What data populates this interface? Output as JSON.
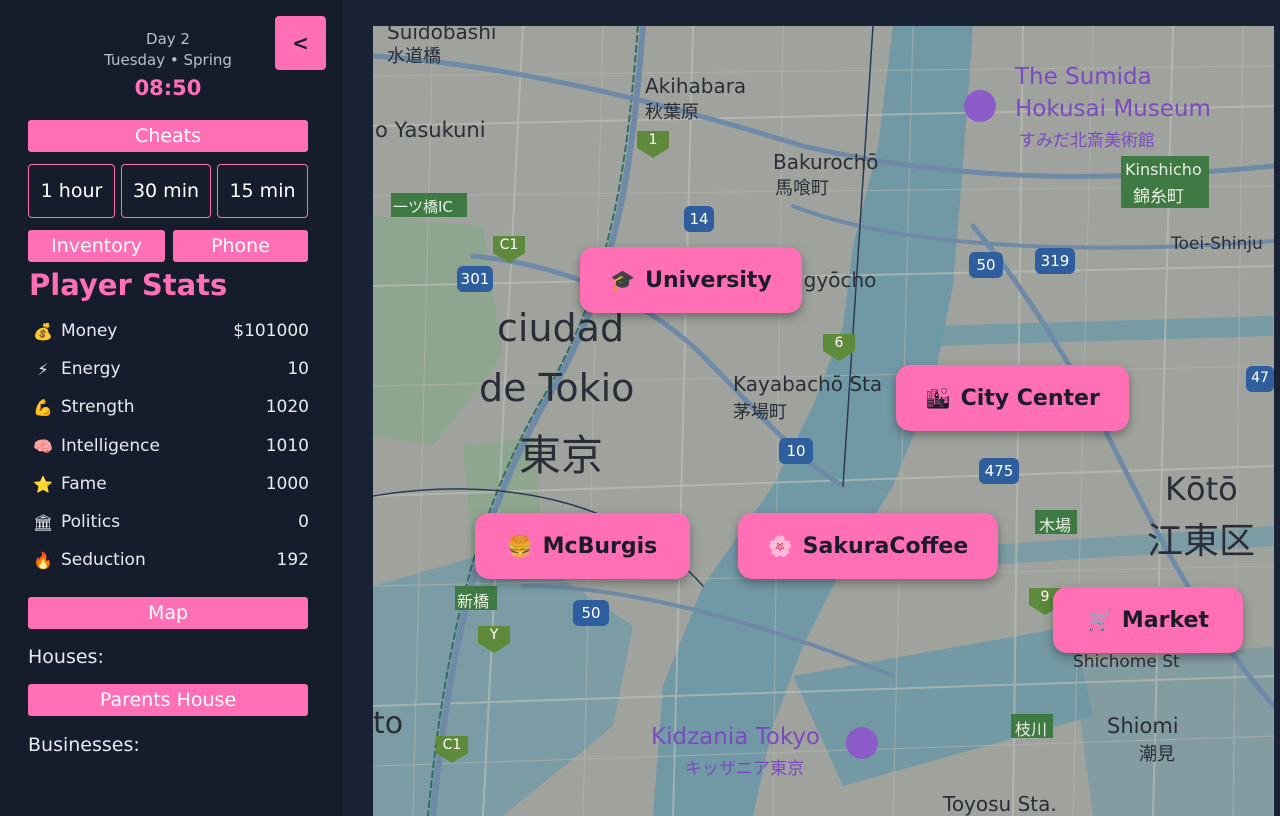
{
  "clock": {
    "day": "Day 2",
    "weekday_season": "Tuesday • Spring",
    "time": "08:50"
  },
  "collapse_label": "<",
  "cheats_label": "Cheats",
  "time_buttons": [
    "1 hour",
    "30 min",
    "15 min"
  ],
  "inventory_label": "Inventory",
  "phone_label": "Phone",
  "stats": {
    "title": "Player Stats",
    "rows": [
      {
        "icon": "💰",
        "icon_name": "money-bag-icon",
        "label": "Money",
        "value": "$101000"
      },
      {
        "icon": "⚡",
        "icon_name": "lightning-icon",
        "label": "Energy",
        "value": "10"
      },
      {
        "icon": "💪",
        "icon_name": "flexed-arm-icon",
        "label": "Strength",
        "value": "1020"
      },
      {
        "icon": "🧠",
        "icon_name": "brain-icon",
        "label": "Intelligence",
        "value": "1010"
      },
      {
        "icon": "⭐",
        "icon_name": "star-icon",
        "label": "Fame",
        "value": "1000"
      },
      {
        "icon": "🏛",
        "icon_name": "government-building-icon",
        "label": "Politics",
        "value": "0"
      },
      {
        "icon": "🔥",
        "icon_name": "fire-icon",
        "label": "Seduction",
        "value": "192"
      }
    ]
  },
  "map_label": "Map",
  "houses_label": "Houses:",
  "houses": [
    "Parents House"
  ],
  "businesses_label": "Businesses:",
  "map_labels": {
    "ciudad": "ciudad",
    "detokio": "de Tokio",
    "tokyo_kanji": "東京",
    "akihabara": "Akihabara",
    "akihabara_jp": "秋葉原",
    "bakurocho": "Bakurochō",
    "bakurocho_jp": "馬喰町",
    "kayabacho": "Kayabachō Sta",
    "kayabacho_jp": "茅場町",
    "sumida1": "The Sumida",
    "sumida2": "Hokusai Museum",
    "sumida_jp": "すみだ北斎美術館",
    "kinshicho": "Kinshicho",
    "kinshicho_jp": "錦糸町",
    "koto": "Kōtō",
    "koto_jp": "江東区",
    "shiomi": "Shiomi",
    "shiomi_jp": "潮見",
    "kidzania": "Kidzania Tokyo",
    "kidzania_jp": "キッザニア東京",
    "toyosu": "Toyosu Sta.",
    "yasukuni": "o Yasukuni",
    "suidobashi": "Suidobashi",
    "suidobashi_jp": "水道橋",
    "ningyocho": "ngyōcho",
    "shichome": "Shichome St",
    "tokyo_left": "to",
    "hitotsubashi": "一ツ橋IC",
    "kiba": "木場",
    "shinbashi": "新橋",
    "edagawa": "枝川",
    "toei": "Toei-Shinju"
  },
  "route_numbers": [
    "1",
    "14",
    "C1",
    "301",
    "6",
    "10",
    "50",
    "319",
    "475",
    "50",
    "9",
    "Y",
    "C1",
    "47"
  ],
  "locations": [
    {
      "icon": "🎓",
      "icon_name": "graduation-cap-icon",
      "label": "University"
    },
    {
      "icon": "🏙",
      "icon_name": "city-buildings-icon",
      "label": "City Center"
    },
    {
      "icon": "🍔",
      "icon_name": "burger-icon",
      "label": "McBurgis"
    },
    {
      "icon": "🌸",
      "icon_name": "cherry-blossom-icon",
      "label": "SakuraCoffee"
    },
    {
      "icon": "🛒",
      "icon_name": "shopping-cart-icon",
      "label": "Market"
    }
  ],
  "colors": {
    "accent": "#ff6fb5",
    "sidebar_bg": "#151c2c",
    "page_bg": "#1a2235",
    "map_water": "#6b98a6",
    "map_land": "#a0a39d"
  }
}
